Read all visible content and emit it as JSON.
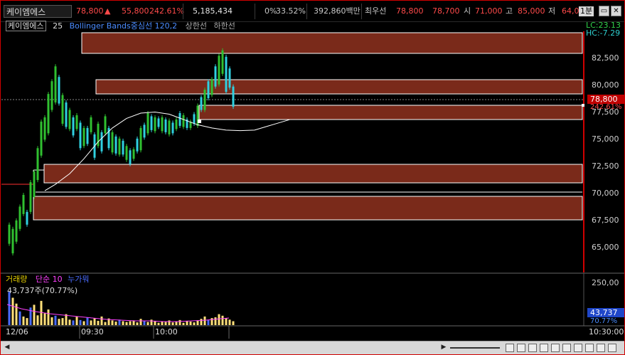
{
  "toolbar": {
    "ticker": "케이엠에스",
    "price": "78,800",
    "change_arrow": "▲",
    "change": "55,800",
    "change_pct": "242.61%",
    "volume": "5,185,434",
    "stat1": "0%",
    "stat2": "33.52%",
    "amount": "392,860백만",
    "best_label": "최우선",
    "best_ask": "78,800",
    "best_bid": "78,700",
    "open_label": "시",
    "open": "71,000",
    "high_label": "고",
    "high": "85,000",
    "low_label": "저",
    "low": "64,0",
    "interval": "1분",
    "accent": "#ff4a4a"
  },
  "legend": {
    "name": "케이엠에스",
    "period": "25",
    "bollinger": "Bollinger Bands중심선 120,2",
    "upper": "상한선",
    "lower": "하한선"
  },
  "price_axis": [
    "82,500",
    "80,000",
    "77,500",
    "75,000",
    "72,500",
    "70,000",
    "67,500",
    "65,000"
  ],
  "lc_label": "LC:23.13",
  "hc_label": "HC:-7.29",
  "price_tag": "78,800",
  "pct_tag": "242.61%",
  "volume_legend": {
    "label": "거래량",
    "ma": "단순 10",
    "ma2": "누가뭐"
  },
  "volume_value": "43,737주(70.77%)",
  "volume_axis": "250,00",
  "volume_tag": "43,737",
  "volume_pct_tag": "70.77%",
  "time_axis": {
    "date": "12/06",
    "t1": "09:30",
    "t2": "10:00",
    "right": "10:30:00"
  },
  "colors": {
    "up": "#ff3030",
    "down": "#2fd0e0",
    "up_green": "#30c030",
    "zone": "#7a2a1a",
    "bb": "#ffffff",
    "vol_up": "#ffe07a",
    "vol_down": "#4a6cff"
  },
  "chart_data": {
    "type": "candlestick",
    "ylim": [
      63500,
      86200
    ],
    "ma_line": [
      [
        11,
        71200
      ],
      [
        14,
        71800
      ],
      [
        18,
        72800
      ],
      [
        22,
        74200
      ],
      [
        26,
        75800
      ],
      [
        30,
        77100
      ],
      [
        34,
        78000
      ],
      [
        38,
        78500
      ],
      [
        42,
        78600
      ],
      [
        46,
        78400
      ],
      [
        50,
        77900
      ],
      [
        54,
        77400
      ],
      [
        58,
        77100
      ],
      [
        62,
        76900
      ],
      [
        66,
        76850
      ],
      [
        70,
        76900
      ],
      [
        74,
        77300
      ],
      [
        78,
        77700
      ],
      [
        80,
        77900
      ]
    ],
    "candles_up": [
      [
        1,
        68000,
        66200
      ],
      [
        2,
        67600,
        65300
      ],
      [
        3,
        68400,
        66400
      ],
      [
        4,
        69700,
        67600
      ],
      [
        5,
        70800,
        69000
      ],
      [
        7,
        72000,
        69200
      ],
      [
        8,
        73000,
        70600
      ],
      [
        9,
        75200,
        72200
      ],
      [
        10,
        77700,
        74500
      ],
      [
        11,
        78100,
        76000
      ],
      [
        12,
        80300,
        76600
      ],
      [
        13,
        81500,
        78800
      ],
      [
        14,
        82900,
        79500
      ],
      [
        16,
        80200,
        77500
      ],
      [
        18,
        78800,
        77000
      ],
      [
        20,
        78300,
        77000
      ],
      [
        22,
        77100,
        75400
      ],
      [
        24,
        78100,
        76700
      ],
      [
        26,
        77500,
        75400
      ],
      [
        28,
        78200,
        76600
      ],
      [
        30,
        76700,
        74800
      ],
      [
        32,
        76100,
        74600
      ],
      [
        34,
        75400,
        74100
      ],
      [
        36,
        75100,
        74200
      ],
      [
        38,
        77100,
        75000
      ],
      [
        40,
        78500,
        76600
      ],
      [
        42,
        78100,
        76800
      ],
      [
        44,
        78100,
        76800
      ],
      [
        46,
        77800,
        76500
      ],
      [
        48,
        77900,
        77000
      ],
      [
        50,
        78300,
        77200
      ],
      [
        52,
        77700,
        77100
      ],
      [
        54,
        79200,
        77300
      ],
      [
        56,
        80700,
        78800
      ],
      [
        58,
        81700,
        80200
      ],
      [
        60,
        83900,
        81200
      ],
      [
        61,
        84400,
        82200
      ]
    ],
    "candles_down": [
      [
        6,
        69200,
        68000
      ],
      [
        15,
        81900,
        79400
      ],
      [
        17,
        79500,
        77200
      ],
      [
        19,
        78100,
        76400
      ],
      [
        21,
        77600,
        75200
      ],
      [
        23,
        77100,
        75600
      ],
      [
        25,
        76500,
        74300
      ],
      [
        27,
        76700,
        74900
      ],
      [
        29,
        77100,
        75200
      ],
      [
        31,
        76300,
        74700
      ],
      [
        33,
        75900,
        74600
      ],
      [
        35,
        75000,
        73700
      ],
      [
        37,
        76100,
        74900
      ],
      [
        39,
        77400,
        76200
      ],
      [
        41,
        78200,
        76900
      ],
      [
        43,
        78000,
        77200
      ],
      [
        45,
        77900,
        76700
      ],
      [
        47,
        77600,
        76600
      ],
      [
        49,
        78500,
        77300
      ],
      [
        51,
        77900,
        77100
      ],
      [
        53,
        78400,
        77500
      ],
      [
        55,
        80000,
        78800
      ],
      [
        57,
        81500,
        79900
      ],
      [
        59,
        82900,
        81000
      ],
      [
        62,
        83800,
        80500
      ],
      [
        63,
        82700,
        80900
      ],
      [
        64,
        81000,
        79100
      ]
    ],
    "volumes": [
      [
        1,
        85,
        "d"
      ],
      [
        2,
        70,
        "u"
      ],
      [
        3,
        55,
        "u"
      ],
      [
        4,
        35,
        "d"
      ],
      [
        5,
        22,
        "u"
      ],
      [
        6,
        18,
        "u"
      ],
      [
        7,
        45,
        "d"
      ],
      [
        8,
        52,
        "u"
      ],
      [
        9,
        25,
        "u"
      ],
      [
        10,
        62,
        "u"
      ],
      [
        11,
        30,
        "u"
      ],
      [
        12,
        40,
        "u"
      ],
      [
        13,
        20,
        "u"
      ],
      [
        14,
        24,
        "d"
      ],
      [
        15,
        16,
        "u"
      ],
      [
        16,
        18,
        "u"
      ],
      [
        17,
        28,
        "u"
      ],
      [
        18,
        14,
        "u"
      ],
      [
        19,
        12,
        "d"
      ],
      [
        20,
        22,
        "u"
      ],
      [
        21,
        13,
        "d"
      ],
      [
        22,
        10,
        "u"
      ],
      [
        23,
        20,
        "d"
      ],
      [
        24,
        12,
        "u"
      ],
      [
        25,
        18,
        "u"
      ],
      [
        26,
        11,
        "u"
      ],
      [
        27,
        22,
        "u"
      ],
      [
        28,
        8,
        "u"
      ],
      [
        29,
        17,
        "u"
      ],
      [
        30,
        12,
        "u"
      ],
      [
        31,
        9,
        "u"
      ],
      [
        32,
        14,
        "d"
      ],
      [
        33,
        10,
        "u"
      ],
      [
        34,
        8,
        "u"
      ],
      [
        35,
        10,
        "u"
      ],
      [
        36,
        12,
        "u"
      ],
      [
        37,
        7,
        "u"
      ],
      [
        38,
        16,
        "u"
      ],
      [
        39,
        10,
        "d"
      ],
      [
        40,
        8,
        "u"
      ],
      [
        41,
        14,
        "u"
      ],
      [
        42,
        11,
        "u"
      ],
      [
        43,
        6,
        "u"
      ],
      [
        44,
        10,
        "u"
      ],
      [
        45,
        8,
        "u"
      ],
      [
        46,
        12,
        "u"
      ],
      [
        47,
        7,
        "u"
      ],
      [
        48,
        9,
        "u"
      ],
      [
        49,
        13,
        "u"
      ],
      [
        50,
        6,
        "u"
      ],
      [
        51,
        11,
        "u"
      ],
      [
        52,
        9,
        "u"
      ],
      [
        53,
        7,
        "u"
      ],
      [
        54,
        12,
        "u"
      ],
      [
        55,
        16,
        "u"
      ],
      [
        56,
        22,
        "u"
      ],
      [
        57,
        14,
        "d"
      ],
      [
        58,
        18,
        "u"
      ],
      [
        59,
        20,
        "u"
      ],
      [
        60,
        28,
        "u"
      ],
      [
        61,
        24,
        "u"
      ],
      [
        62,
        18,
        "u"
      ],
      [
        63,
        14,
        "u"
      ],
      [
        64,
        10,
        "u"
      ]
    ]
  }
}
